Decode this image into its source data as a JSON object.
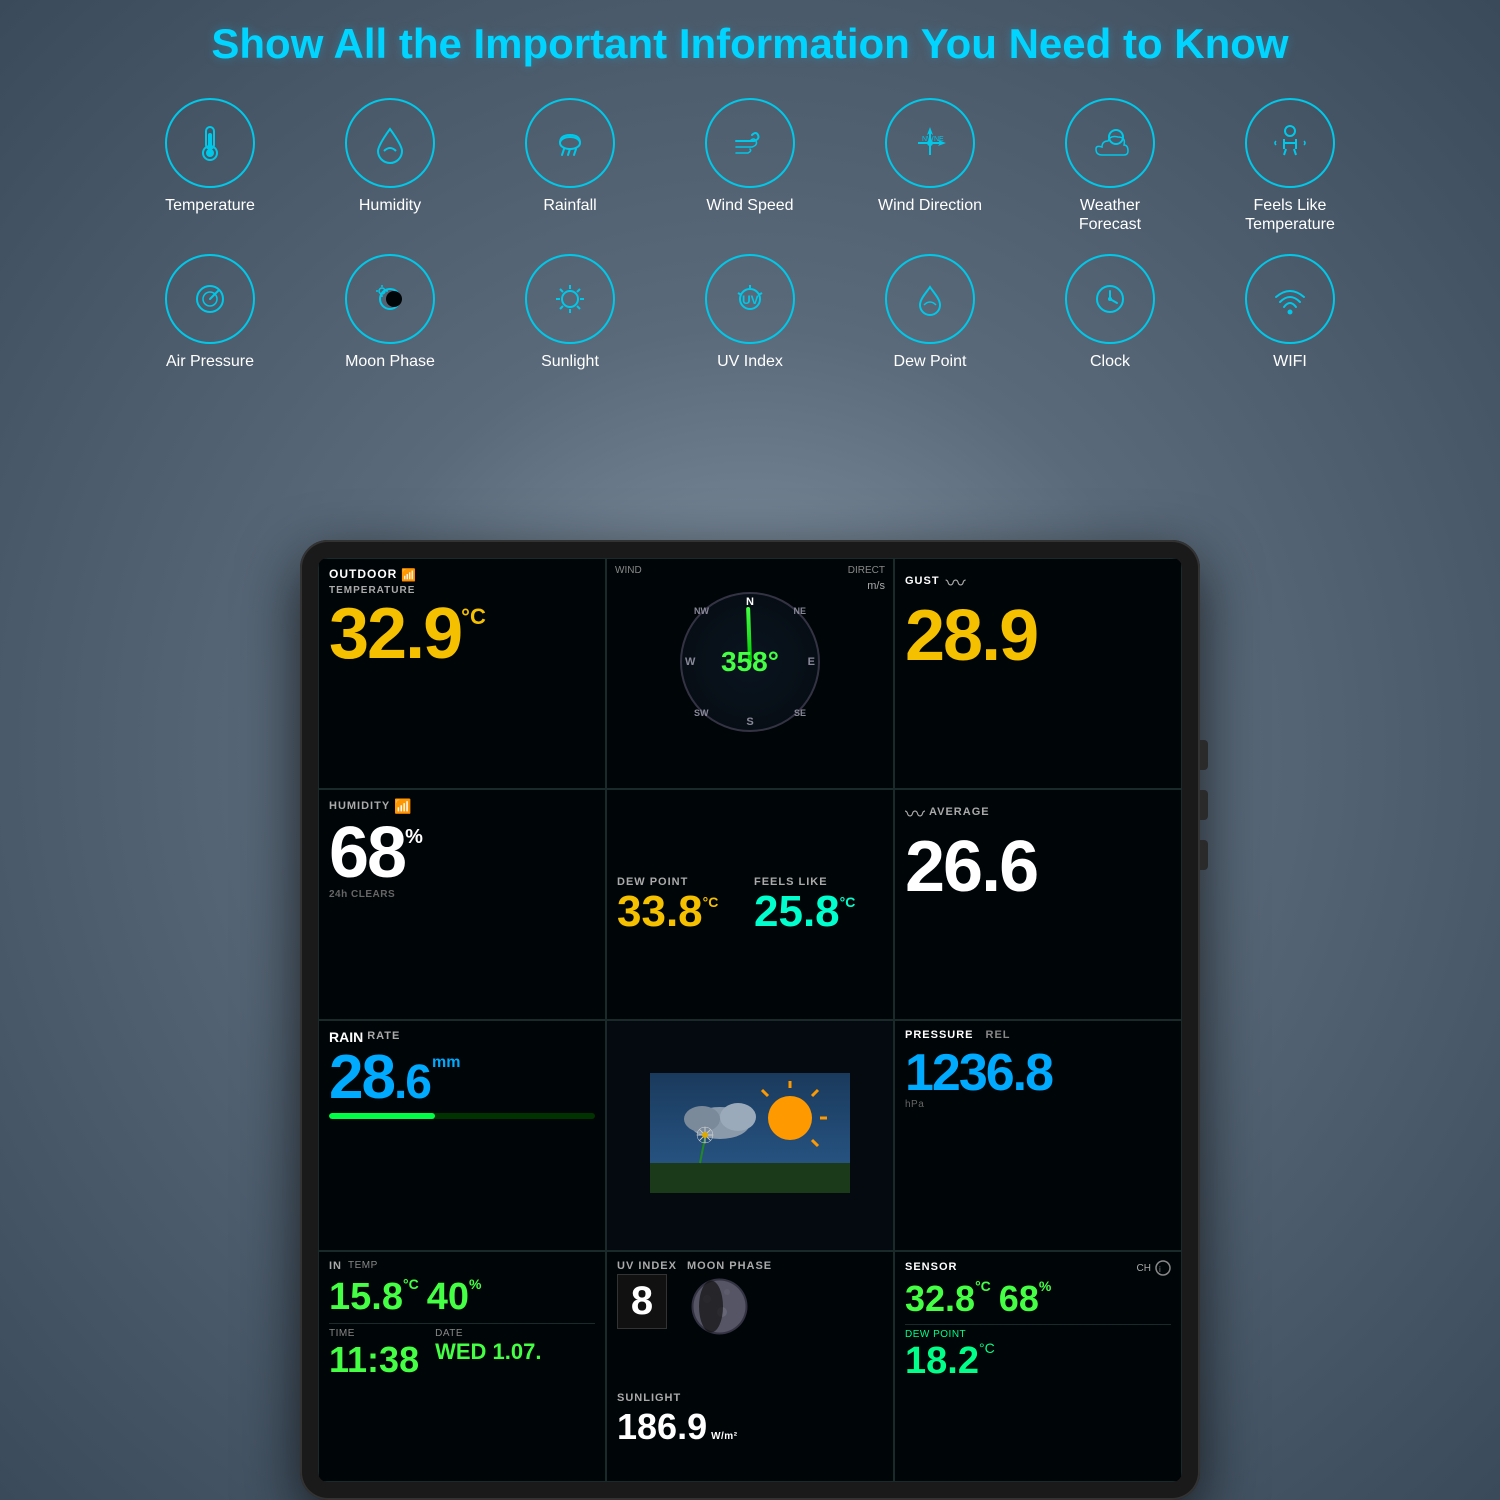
{
  "headline": "Show All the Important Information You Need to Know",
  "icons_row1": [
    {
      "id": "temperature",
      "label": "Temperature",
      "symbol": "🌡"
    },
    {
      "id": "humidity",
      "label": "Humidity",
      "symbol": "💧"
    },
    {
      "id": "rainfall",
      "label": "Rainfall",
      "symbol": "🌧"
    },
    {
      "id": "wind-speed",
      "label": "Wind Speed",
      "symbol": "💨"
    },
    {
      "id": "wind-direction",
      "label": "Wind Direction",
      "symbol": "🧭"
    },
    {
      "id": "weather-forecast",
      "label": "Weather Forecast",
      "symbol": "⛅"
    },
    {
      "id": "feels-like",
      "label": "Feels Like Temperature",
      "symbol": "🧍"
    }
  ],
  "icons_row2": [
    {
      "id": "air-pressure",
      "label": "Air Pressure",
      "symbol": "🔵"
    },
    {
      "id": "moon-phase",
      "label": "Moon Phase",
      "symbol": "🌙"
    },
    {
      "id": "sunlight",
      "label": "Sunlight",
      "symbol": "☀"
    },
    {
      "id": "uv-index",
      "label": "UV Index",
      "symbol": "🔆"
    },
    {
      "id": "dew-point",
      "label": "Dew Point",
      "symbol": "🍃"
    },
    {
      "id": "clock",
      "label": "Clock",
      "symbol": "🕐"
    },
    {
      "id": "wifi",
      "label": "WIFI",
      "symbol": "📶"
    }
  ],
  "display": {
    "outdoor_label": "OUTDOOR",
    "temperature_label": "TEMPERATURE",
    "temperature_value": "32.9",
    "temperature_unit": "°C",
    "wind_label": "WIND",
    "wind_direction_label": "DIRECT",
    "wind_compass_value": "358°",
    "wind_ms_label": "m/s",
    "gust_label": "GUST",
    "gust_value": "28.9",
    "humidity_label": "HUMIDITY",
    "humidity_value": "68",
    "humidity_unit": "%",
    "wifi_label": "WiFi",
    "clears_label": "24h CLEARS",
    "dew_point_label": "DEW POINT",
    "dew_point_value": "33.8",
    "dew_point_unit": "°C",
    "feels_like_label": "FEELS LIKE",
    "feels_like_value": "25.8",
    "feels_like_unit": "°C",
    "average_label": "AVERAGE",
    "average_value": "26.6",
    "rain_label": "RAIN",
    "rain_rate_label": "RATE",
    "rain_value": "286",
    "rain_decimal": ".6",
    "rain_unit": "mm",
    "pressure_label": "PRESSURE",
    "pressure_rel_label": "REL",
    "pressure_value": "1236.8",
    "pressure_unit": "hPa",
    "indoor_label": "IN",
    "indoor_temp_label": "TEMP",
    "indoor_temp_value": "15.8",
    "indoor_temp_unit": "°C",
    "indoor_humidity_value": "40",
    "indoor_humidity_unit": "%",
    "time_label": "TIME",
    "time_value": "11:38",
    "date_label": "DATE",
    "date_value": "WED 1.07.",
    "uv_label": "UV INDEX",
    "uv_value": "8",
    "moon_label": "MOON PHASE",
    "sunlight_label": "SUNLIGHT",
    "sunlight_value": "186.9",
    "sunlight_unit": "W/m²",
    "sensor_label": "SENSOR",
    "sensor_temp_value": "32.8",
    "sensor_temp_unit": "°C",
    "sensor_humidity_value": "68",
    "sensor_humidity_unit": "%",
    "sensor_ch_label": "CH",
    "sensor_dew_label": "DEW POINT",
    "sensor_dew_value": "18.2",
    "sensor_dew_unit": "°C"
  }
}
